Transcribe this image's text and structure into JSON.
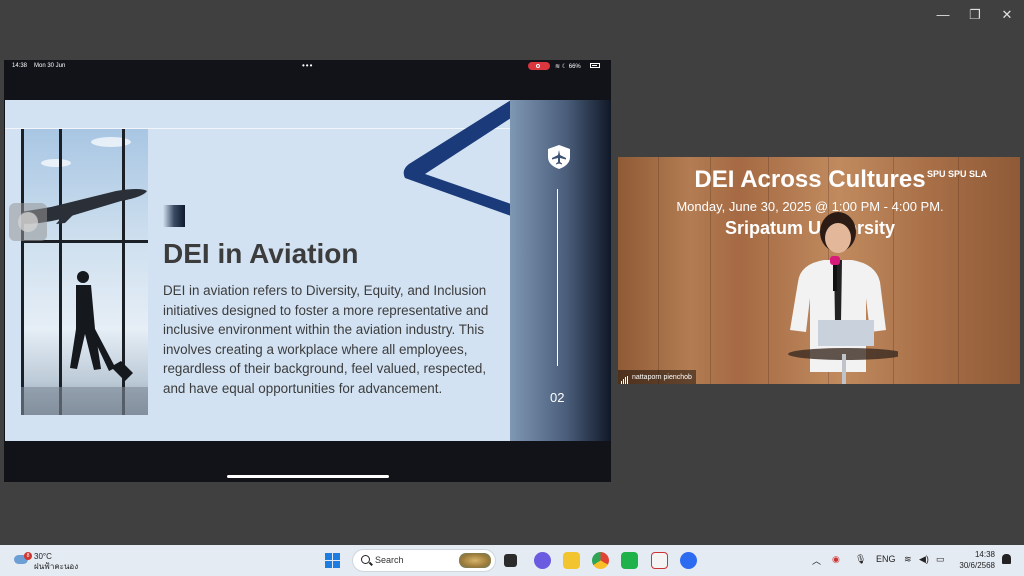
{
  "window": {
    "min_label": "—",
    "restore_label": "❐",
    "close_label": "✕"
  },
  "share": {
    "status": {
      "time": "14:38",
      "date": "Mon 30 Jun",
      "dots": "•••",
      "battery": "66%"
    },
    "slide": {
      "title": "DEI in Aviation",
      "body": "DEI in aviation refers to Diversity, Equity, and Inclusion initiatives designed to foster a more representative and inclusive environment within the aviation industry. This involves creating a workplace where all employees, regardless of their background, feel valued, respected, and have equal opportunities for advancement.",
      "page": "02"
    }
  },
  "camera": {
    "title": "DEI Across Cultures",
    "date": "Monday, June 30, 2025 @ 1:00 PM - 4:00 PM.",
    "venue": "Sripatum University",
    "logos": "SPU SPU SLA",
    "participant": "nattaporn pienchob"
  },
  "taskbar": {
    "weather_temp": "30°C",
    "weather_desc": "ฝนฟ้าคะนอง",
    "weather_badge": "8",
    "search_label": "Search",
    "lang": "ENG",
    "time": "14:38",
    "date": "30/6/2568",
    "tray_chevron": "︿"
  }
}
